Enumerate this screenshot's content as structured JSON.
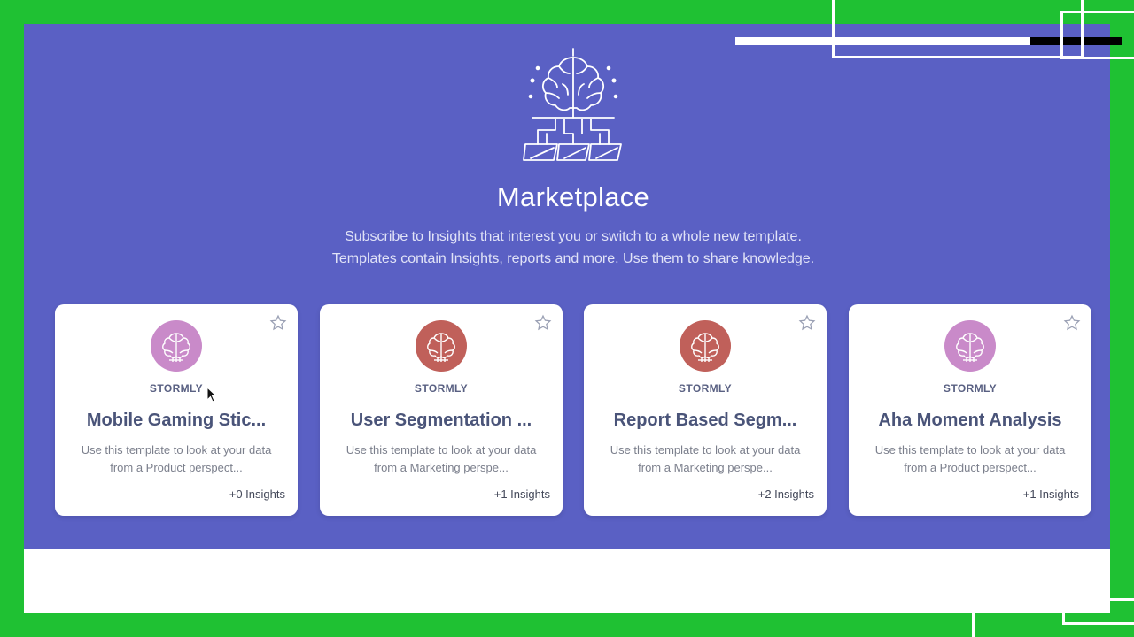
{
  "marketplace": {
    "title": "Marketplace",
    "subtitle_line1": "Subscribe to Insights that interest you or switch to a whole new template.",
    "subtitle_line2": "Templates contain Insights, reports and more. Use them to share knowledge.",
    "icon": "brain-network-icon"
  },
  "colors": {
    "hero_background": "#5a60c4",
    "avatar_pink": "#c98ac9",
    "avatar_red": "#c0605a",
    "title_text": "#4a5479"
  },
  "cards": [
    {
      "author": "STORMLY",
      "title": "Mobile Gaming Stic...",
      "desc_line1": "Use this template to look at your data",
      "desc_line2": "from a Product perspect...",
      "insights": "+0 Insights",
      "avatar_color": "#c98ac9"
    },
    {
      "author": "STORMLY",
      "title": "User Segmentation ...",
      "desc_line1": "Use this template to look at your data",
      "desc_line2": "from a Marketing perspe...",
      "insights": "+1 Insights",
      "avatar_color": "#c0605a"
    },
    {
      "author": "STORMLY",
      "title": "Report Based Segm...",
      "desc_line1": "Use this template to look at your data",
      "desc_line2": "from a Marketing perspe...",
      "insights": "+2 Insights",
      "avatar_color": "#c0605a"
    },
    {
      "author": "STORMLY",
      "title": "Aha Moment Analysis",
      "desc_line1": "Use this template to look at your data",
      "desc_line2": "from a Product perspect...",
      "insights": "+1 Insights",
      "avatar_color": "#c98ac9"
    }
  ]
}
